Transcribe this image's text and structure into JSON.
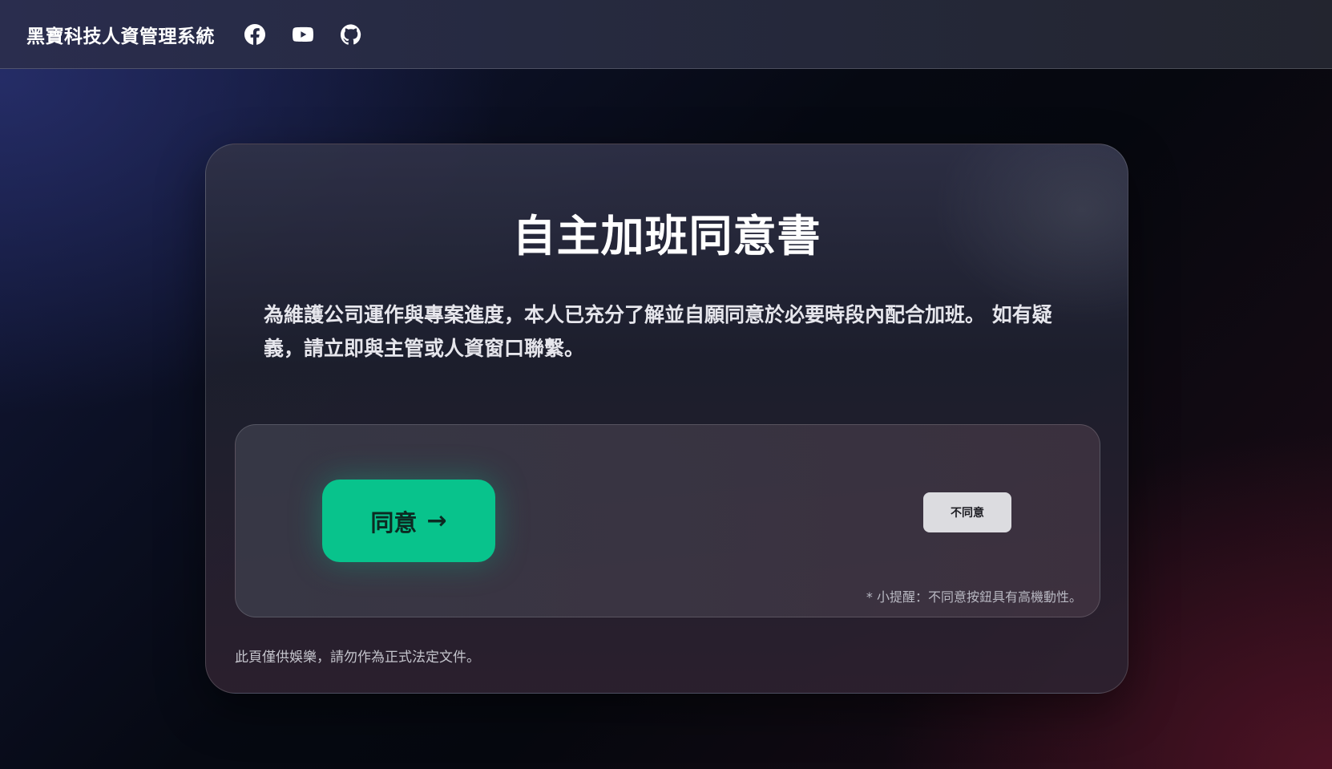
{
  "header": {
    "brand": "黑寶科技人資管理系統",
    "social_icons": [
      "facebook-icon",
      "youtube-icon",
      "github-icon"
    ]
  },
  "card": {
    "title": "自主加班同意書",
    "description": "為維護公司運作與專案進度，本人已充分了解並自願同意於必要時段內配合加班。 如有疑義，請立即與主管或人資窗口聯繫。",
    "agree_label": "同意",
    "agree_arrow": "→",
    "disagree_label": "不同意",
    "hint": "* 小提醒：不同意按鈕具有高機動性。",
    "footnote": "此頁僅供娛樂，請勿作為正式法定文件。"
  },
  "colors": {
    "accent": "#08c38c",
    "disagree_bg": "#dcdce0"
  }
}
